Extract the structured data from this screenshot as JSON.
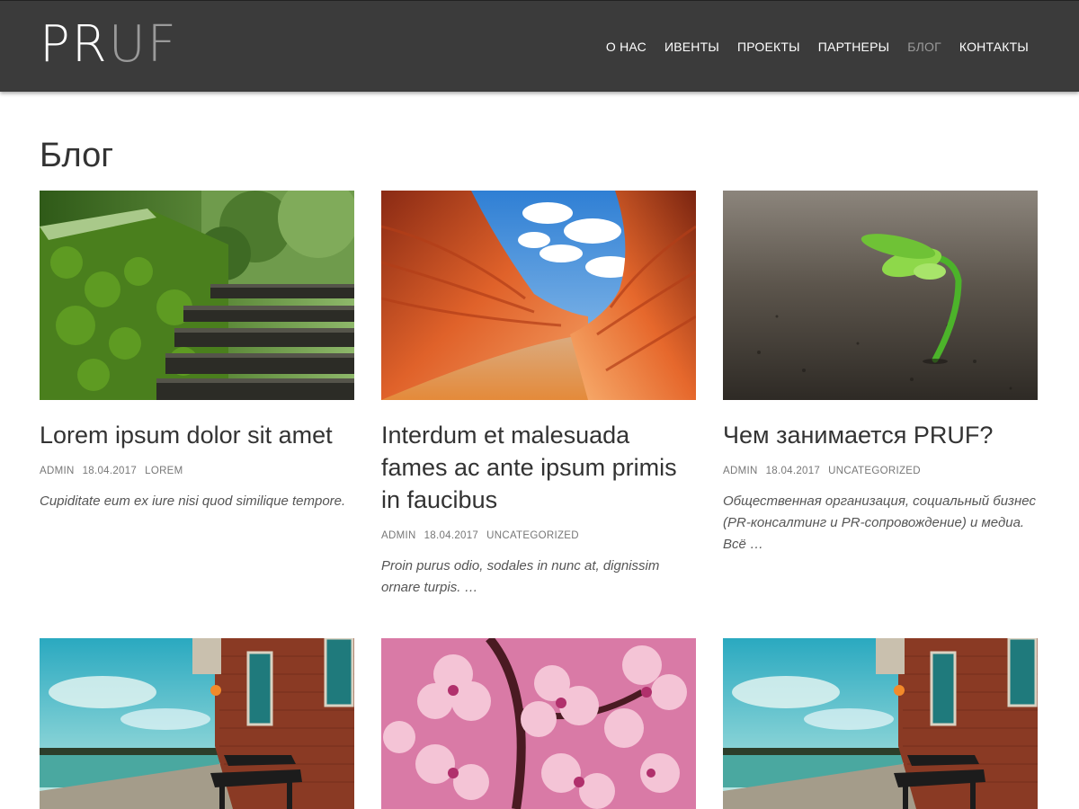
{
  "header": {
    "logo_a": "PR",
    "logo_b": "UF",
    "nav": [
      "О НАС",
      "ИВЕНТЫ",
      "ПРОЕКТЫ",
      "ПАРТНЕРЫ",
      "БЛОГ",
      "КОНТАКТЫ"
    ],
    "active_nav": "БЛОГ"
  },
  "page": {
    "title": "Блог"
  },
  "posts": [
    {
      "title": "Lorem ipsum dolor sit amet",
      "author": "ADMIN",
      "date": "18.04.2017",
      "category": "LOREM",
      "excerpt": "Cupiditate eum ex iure nisi quod similique tempore.",
      "image": "mossy-stone-steps"
    },
    {
      "title": "Interdum et malesuada fames ac ante ipsum primis in faucibus",
      "author": "ADMIN",
      "date": "18.04.2017",
      "category": "UNCATEGORIZED",
      "excerpt": "Proin purus odio, sodales in nunc at, dignissim ornare turpis. …",
      "image": "red-sandstone-canyon"
    },
    {
      "title": "Чем занимается PRUF?",
      "author": "ADMIN",
      "date": "18.04.2017",
      "category": "UNCATEGORIZED",
      "excerpt": "Общественная организация, социальный бизнес (PR-консалтинг и PR-сопровождение) и медиа. Всё …",
      "image": "green-sprout"
    },
    {
      "image": "waterfront-bench"
    },
    {
      "image": "pink-blossoms"
    },
    {
      "image": "waterfront-bench"
    }
  ],
  "colors": {
    "header_bg": "#3b3b3b",
    "nav_text": "#ffffff",
    "nav_active": "#9a9a9a",
    "text": "#333333",
    "meta": "#777777"
  }
}
